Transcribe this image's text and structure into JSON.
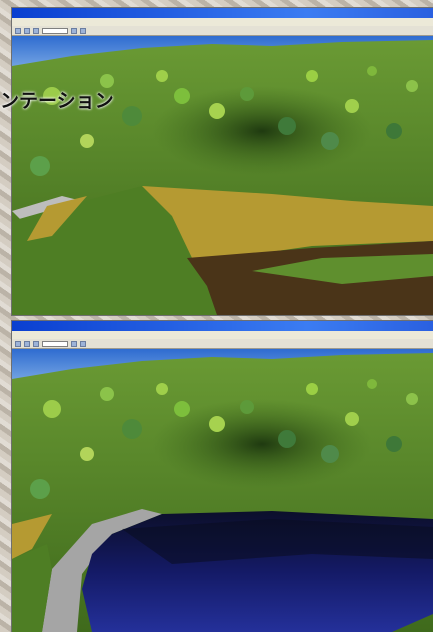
{
  "overlay_text": "ンテーション",
  "windows": [
    {
      "title": "",
      "menu": [
        "",
        "",
        "",
        ""
      ],
      "toolbar_field": ""
    },
    {
      "title": "",
      "menu": [
        "",
        "",
        "",
        ""
      ],
      "toolbar_field": ""
    }
  ],
  "colors": {
    "sky": "#4a86d8",
    "grass": "#4c7a22",
    "hill": "#5e8a2c",
    "field_yellow": "#b59a32",
    "field_brown": "#4a3418",
    "field_green": "#5f8f2e",
    "water": "#141a66",
    "road": "#a5a5a5"
  }
}
